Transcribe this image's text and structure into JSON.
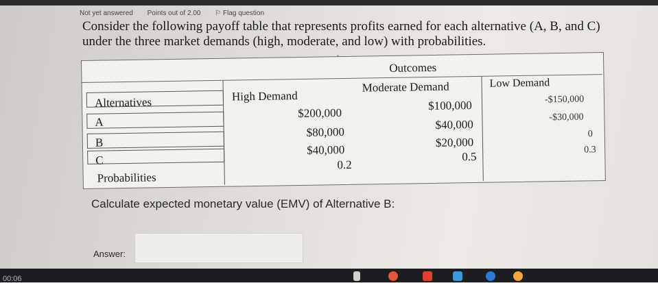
{
  "meta": {
    "status": "Not yet answered",
    "points": "Points out of 2.00",
    "flag": "Flag question"
  },
  "question": {
    "text": "Consider the following payoff table that represents profits earned for each alternative (A, B, and C) under the three market demands (high, moderate, and low) with probabilities."
  },
  "table": {
    "outcomes_header": "Outcomes",
    "col_alternatives": "Alternatives",
    "col_high": "High Demand",
    "col_moderate": "Moderate Demand",
    "col_low": "Low Demand",
    "rows": [
      {
        "label": "A",
        "high": "$200,000",
        "moderate": "$100,000",
        "low": "-$150,000"
      },
      {
        "label": "B",
        "high": "$80,000",
        "moderate": "$40,000",
        "low": "-$30,000"
      },
      {
        "label": "C",
        "high": "$40,000",
        "moderate": "$20,000",
        "low": "0"
      }
    ],
    "prob_label": "Probabilities",
    "prob_high": "0.2",
    "prob_moderate": "0.5",
    "prob_low": "0.3"
  },
  "instruction": "Calculate expected monetary value (EMV) of Alternative B:",
  "answer": {
    "label": "Answer:",
    "value": ""
  },
  "taskbar": {
    "clock": "00:06"
  },
  "colors": {
    "page_bg": "#e2dfdb",
    "table_bg": "#f3f1ee",
    "taskbar": "#1c1e22"
  }
}
